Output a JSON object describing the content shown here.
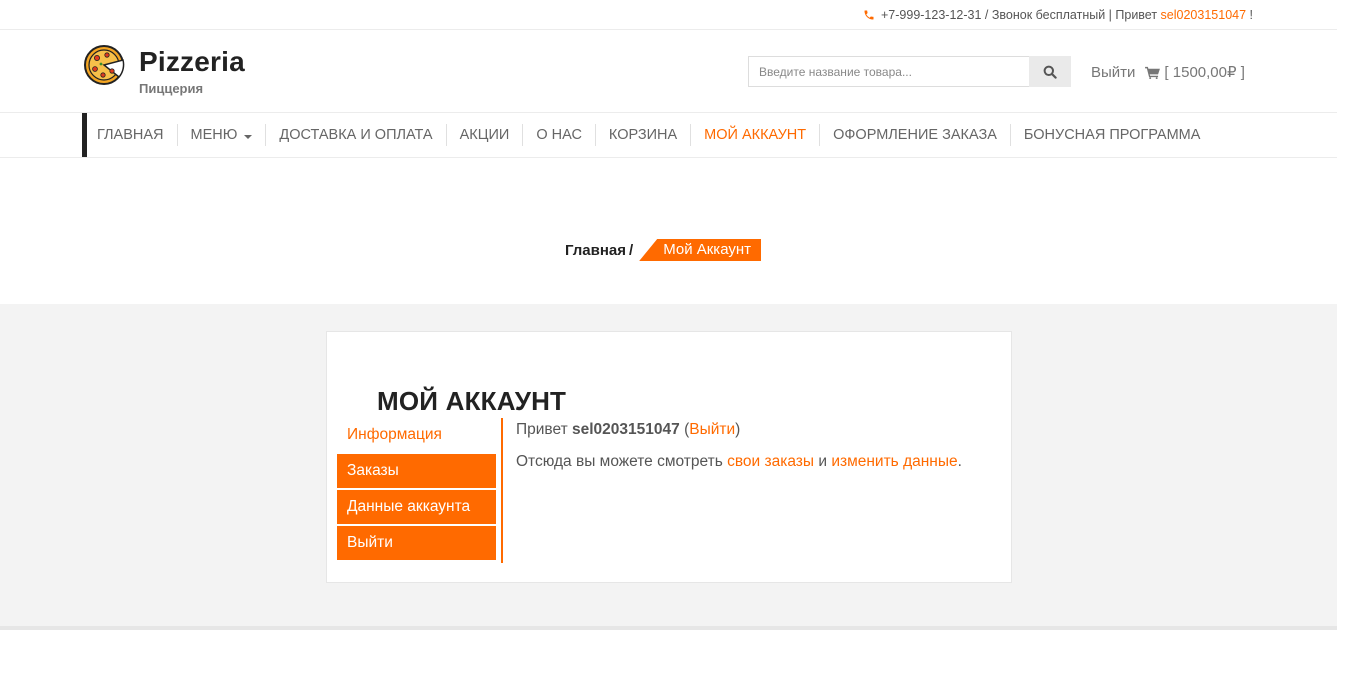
{
  "topbar": {
    "phone": "+7-999-123-12-31",
    "phone_note": " / Звонок бесплатный | Привет ",
    "username": "sel0203151047",
    "exclaim": " !"
  },
  "header": {
    "logo_title": "Pizzeria",
    "logo_subtitle": "Пиццерия",
    "search_placeholder": "Введите название товара...",
    "logout_label": "Выйти",
    "cart_label": "[ 1500,00₽ ]"
  },
  "nav": {
    "items": [
      {
        "label": "ГЛАВНАЯ"
      },
      {
        "label": "МЕНЮ"
      },
      {
        "label": "ДОСТАВКА И ОПЛАТА"
      },
      {
        "label": "АКЦИИ"
      },
      {
        "label": "О НАС"
      },
      {
        "label": "КОРЗИНА"
      },
      {
        "label": "МОЙ АККАУНТ"
      },
      {
        "label": "ОФОРМЛЕНИЕ ЗАКАЗА"
      },
      {
        "label": "БОНУСНАЯ ПРОГРАММА"
      }
    ]
  },
  "breadcrumb": {
    "home": "Главная",
    "separator": "/",
    "current": "Мой Аккаунт"
  },
  "account": {
    "title": "МОЙ АККАУНТ",
    "menu": [
      {
        "label": "Информация"
      },
      {
        "label": "Заказы"
      },
      {
        "label": "Данные аккаунта"
      },
      {
        "label": "Выйти"
      }
    ],
    "greeting_prefix": "Привет ",
    "username": "sel0203151047",
    "logout_open": " (",
    "logout_link": "Выйти",
    "logout_close": ")",
    "desc_prefix": "Отсюда вы можете смотреть ",
    "orders_link": "свои заказы",
    "desc_and": " и ",
    "edit_link": "изменить данные",
    "desc_end": "."
  },
  "colors": {
    "accent": "#ff6a00",
    "dark": "#222222",
    "content_bg": "#f3f3f3"
  },
  "icons": [
    "phone-icon",
    "pizza-logo-icon",
    "search-icon",
    "cart-icon",
    "chevron-down-icon"
  ]
}
